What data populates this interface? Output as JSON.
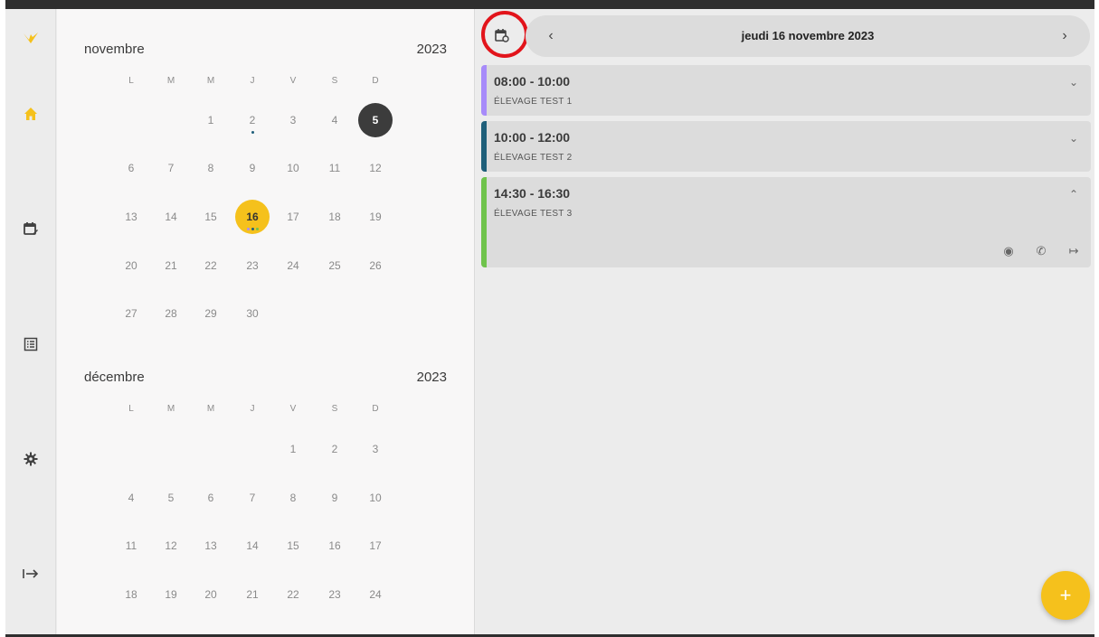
{
  "calendar": {
    "weekdays": [
      "L",
      "M",
      "M",
      "J",
      "V",
      "S",
      "D"
    ],
    "months": [
      {
        "name": "novembre",
        "year": "2023",
        "weeks": [
          [
            "",
            "",
            "1",
            "2",
            "3",
            "4",
            "5"
          ],
          [
            "6",
            "7",
            "8",
            "9",
            "10",
            "11",
            "12"
          ],
          [
            "13",
            "14",
            "15",
            "16",
            "17",
            "18",
            "19"
          ],
          [
            "20",
            "21",
            "22",
            "23",
            "24",
            "25",
            "26"
          ],
          [
            "27",
            "28",
            "29",
            "30",
            "",
            "",
            ""
          ]
        ],
        "today": "5",
        "selected": "16",
        "event_dots": {
          "2": [
            "#1f5f7a"
          ],
          "16": [
            "#a78bfa",
            "#1f5f7a",
            "#6fc34c"
          ]
        }
      },
      {
        "name": "décembre",
        "year": "2023",
        "weeks": [
          [
            "",
            "",
            "",
            "",
            "1",
            "2",
            "3"
          ],
          [
            "4",
            "5",
            "6",
            "7",
            "8",
            "9",
            "10"
          ],
          [
            "11",
            "12",
            "13",
            "14",
            "15",
            "16",
            "17"
          ],
          [
            "18",
            "19",
            "20",
            "21",
            "22",
            "23",
            "24"
          ]
        ]
      }
    ]
  },
  "rail": [
    {
      "name": "logo-icon",
      "icon": "chevron-logo",
      "color": "#f5c11c"
    },
    {
      "name": "home-icon",
      "icon": "home",
      "color": "#f5c11c"
    },
    {
      "name": "calendar-edit-icon",
      "icon": "calendar-edit",
      "color": "#424242"
    },
    {
      "name": "list-icon",
      "icon": "list",
      "color": "#424242"
    },
    {
      "name": "settings-icon",
      "icon": "gear",
      "color": "#424242"
    },
    {
      "name": "logout-icon",
      "icon": "logout-arrow",
      "color": "#424242"
    }
  ],
  "agenda": {
    "date_label": "jeudi 16 novembre 2023",
    "prev_icon": "chevron-left-icon",
    "next_icon": "chevron-right-icon",
    "events": [
      {
        "time": "08:00 - 10:00",
        "name": "ÉLEVAGE TEST 1",
        "color": "#a78bfa",
        "expanded": false
      },
      {
        "time": "10:00 - 12:00",
        "name": "ÉLEVAGE TEST 2",
        "color": "#1f5f7a",
        "expanded": false
      },
      {
        "time": "14:30 - 16:30",
        "name": "ÉLEVAGE TEST 3",
        "color": "#6fc34c",
        "expanded": true
      }
    ]
  },
  "fab": {
    "label": "+",
    "color": "#f5c11c"
  }
}
